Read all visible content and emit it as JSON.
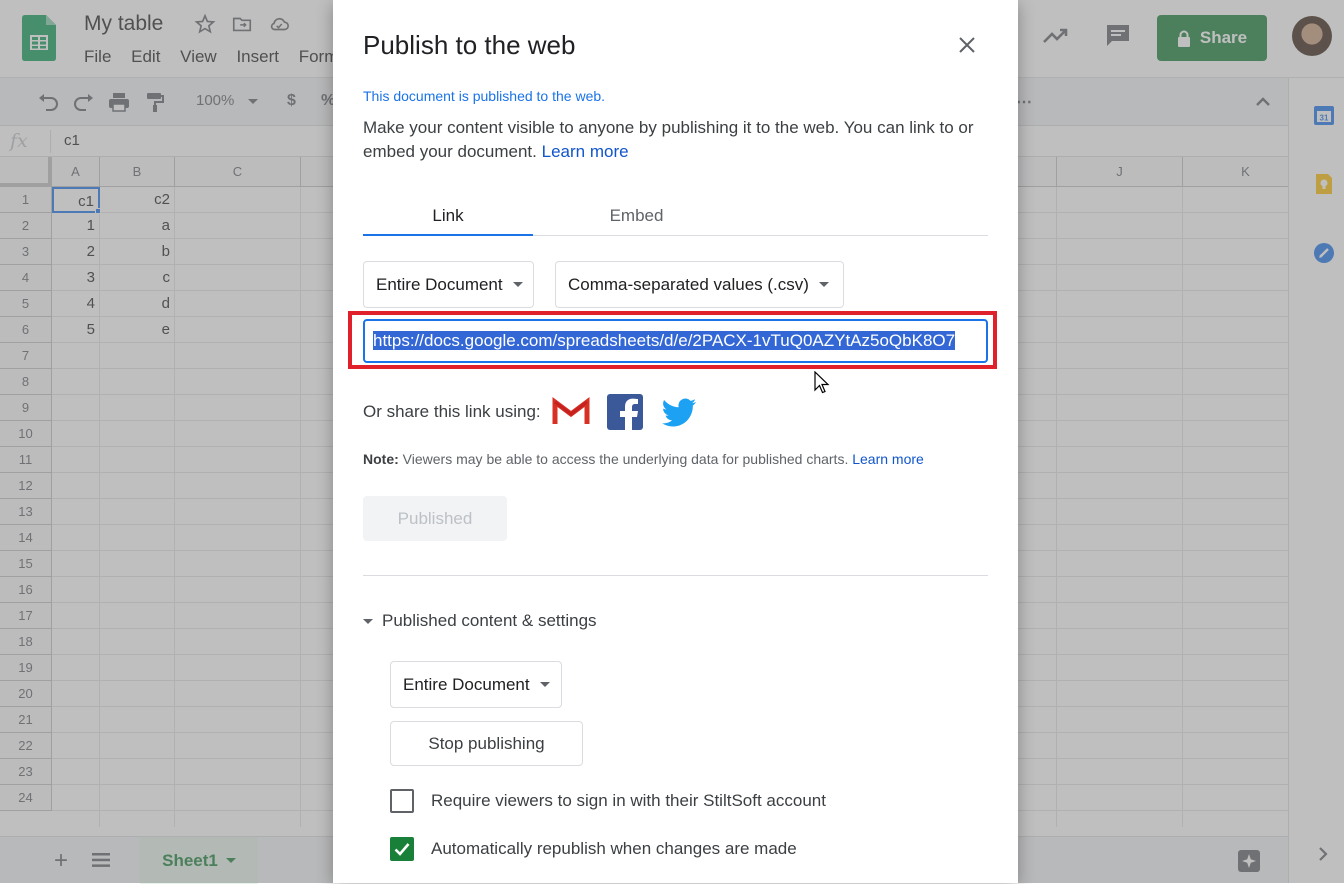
{
  "app": {
    "doc_title": "My table",
    "menu": [
      "File",
      "Edit",
      "View",
      "Insert",
      "Form"
    ],
    "share_label": "Share",
    "zoom": "100%",
    "currency": "$",
    "percent": "%",
    "formula_value": "c1",
    "fx_label": "fx"
  },
  "grid": {
    "columns_left": [
      "A",
      "B",
      "C"
    ],
    "columns_right": [
      "J",
      "K"
    ],
    "rows": [
      "1",
      "2",
      "3",
      "4",
      "5",
      "6",
      "7",
      "8",
      "9",
      "10",
      "11",
      "12",
      "13",
      "14",
      "15",
      "16",
      "17",
      "18",
      "19",
      "20",
      "21",
      "22",
      "23",
      "24"
    ],
    "cells": [
      [
        "c1",
        "c2"
      ],
      [
        "1",
        "a"
      ],
      [
        "2",
        "b"
      ],
      [
        "3",
        "c"
      ],
      [
        "4",
        "d"
      ],
      [
        "5",
        "e"
      ]
    ]
  },
  "bottom": {
    "sheet_name": "Sheet1"
  },
  "dialog": {
    "title": "Publish to the web",
    "published_notice": "This document is published to the web.",
    "description": "Make your content visible to anyone by publishing it to the web. You can link to or embed your document.",
    "learn_more": "Learn more",
    "tabs": [
      "Link",
      "Embed"
    ],
    "scope_dropdown": "Entire Document",
    "format_dropdown": "Comma-separated values (.csv)",
    "url": "https://docs.google.com/spreadsheets/d/e/2PACX-1vTuQ0AZYtAz5oQbK8O7",
    "share_text": "Or share this link using:",
    "note_label": "Note:",
    "note_text": "Viewers may be able to access the underlying data for published charts.",
    "note_learn_more": "Learn more",
    "published_button": "Published",
    "settings_header": "Published content & settings",
    "settings_dropdown": "Entire Document",
    "stop_button": "Stop publishing",
    "checkbox_signin": "Require viewers to sign in with their StiltSoft account",
    "checkbox_signin_checked": false,
    "checkbox_republish": "Automatically republish when changes are made",
    "checkbox_republish_checked": true
  },
  "colors": {
    "accent_blue": "#1a73e8",
    "share_green": "#188038",
    "highlight_red": "#e0202a"
  }
}
